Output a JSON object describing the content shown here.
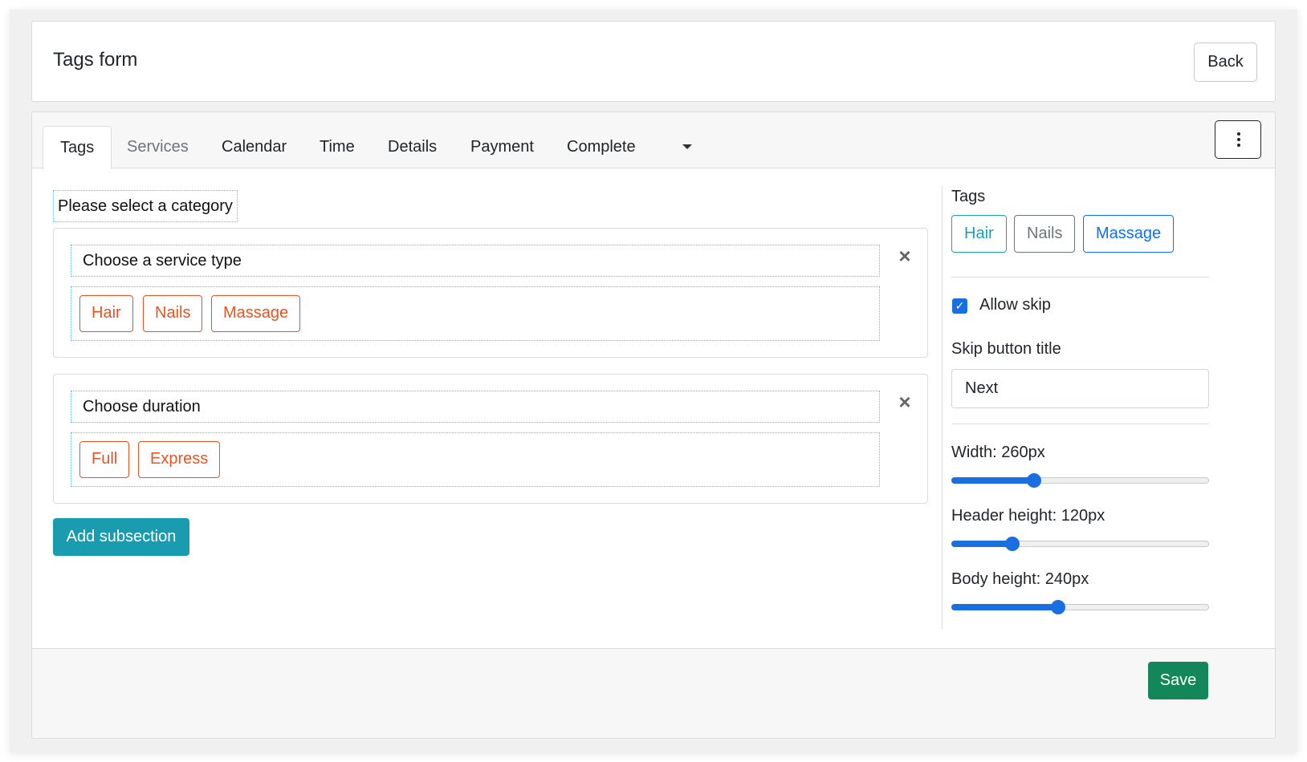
{
  "header": {
    "title": "Tags form",
    "back_label": "Back"
  },
  "tabs": [
    {
      "label": "Tags",
      "state": "active"
    },
    {
      "label": "Services",
      "state": "muted"
    },
    {
      "label": "Calendar",
      "state": "normal"
    },
    {
      "label": "Time",
      "state": "normal"
    },
    {
      "label": "Details",
      "state": "normal"
    },
    {
      "label": "Payment",
      "state": "normal"
    },
    {
      "label": "Complete",
      "state": "normal"
    }
  ],
  "icons": {
    "dropdown": "caret-down-icon",
    "menu": "kebab-menu-icon",
    "remove": "close-icon",
    "check": "checkmark-icon"
  },
  "main": {
    "category_label": "Please select a category",
    "subsections": [
      {
        "title": "Choose a service type",
        "options": [
          "Hair",
          "Nails",
          "Massage"
        ]
      },
      {
        "title": "Choose duration",
        "options": [
          "Full",
          "Express"
        ]
      }
    ],
    "add_subsection_label": "Add subsection"
  },
  "sidebar": {
    "tags_label": "Tags",
    "tags": [
      {
        "label": "Hair",
        "color": "#17a2b8"
      },
      {
        "label": "Nails",
        "color": "#6c757d"
      },
      {
        "label": "Massage",
        "color": "#0d6efd"
      }
    ],
    "allow_skip": {
      "label": "Allow skip",
      "checked": true
    },
    "skip_button_title": {
      "label": "Skip button title",
      "value": "Next"
    },
    "sliders": {
      "width": {
        "label": "Width: 260px",
        "fraction": 0.31
      },
      "header_height": {
        "label": "Header height: 120px",
        "fraction": 0.22
      },
      "body_height": {
        "label": "Body height: 240px",
        "fraction": 0.41
      }
    }
  },
  "footer": {
    "save_label": "Save"
  },
  "colors": {
    "accent_teal": "#1a9cb0",
    "tag_orange": "#e8531f",
    "save_green": "#13875a",
    "slider_blue": "#1a6fe0"
  }
}
